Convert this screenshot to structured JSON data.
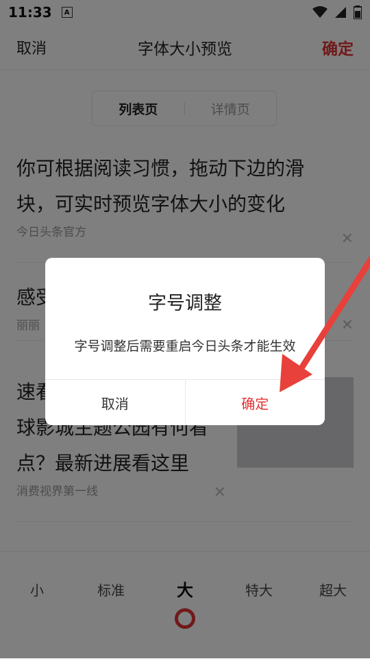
{
  "status_bar": {
    "time": "11:33",
    "icons": [
      "a-icon",
      "wifi-icon",
      "signal-icon",
      "battery-icon"
    ]
  },
  "header": {
    "cancel": "取消",
    "title": "字体大小预览",
    "confirm": "确定"
  },
  "tabs": [
    {
      "label": "列表页",
      "active": true
    },
    {
      "label": "详情页",
      "active": false
    }
  ],
  "feed": [
    {
      "title_lines": [
        "你可根据阅读习惯，拖动下边的滑",
        "块，可实时预览字体大小的变化"
      ],
      "source": "今日头条官方"
    },
    {
      "title_lines": [
        "感受"
      ],
      "source": "丽丽"
    },
    {
      "title_lines": [
        "速看",
        "球影城主题公园有何看",
        "点？最新进展看这里"
      ],
      "source": "消费视界第一线"
    }
  ],
  "size_options": [
    "小",
    "标准",
    "大",
    "特大",
    "超大"
  ],
  "selected_size": "大",
  "dialog": {
    "title": "字号调整",
    "message": "字号调整后需要重启今日头条才能生效",
    "cancel": "取消",
    "confirm": "确定"
  },
  "colors": {
    "accent": "#e23333",
    "arrow": "#e8403a"
  }
}
